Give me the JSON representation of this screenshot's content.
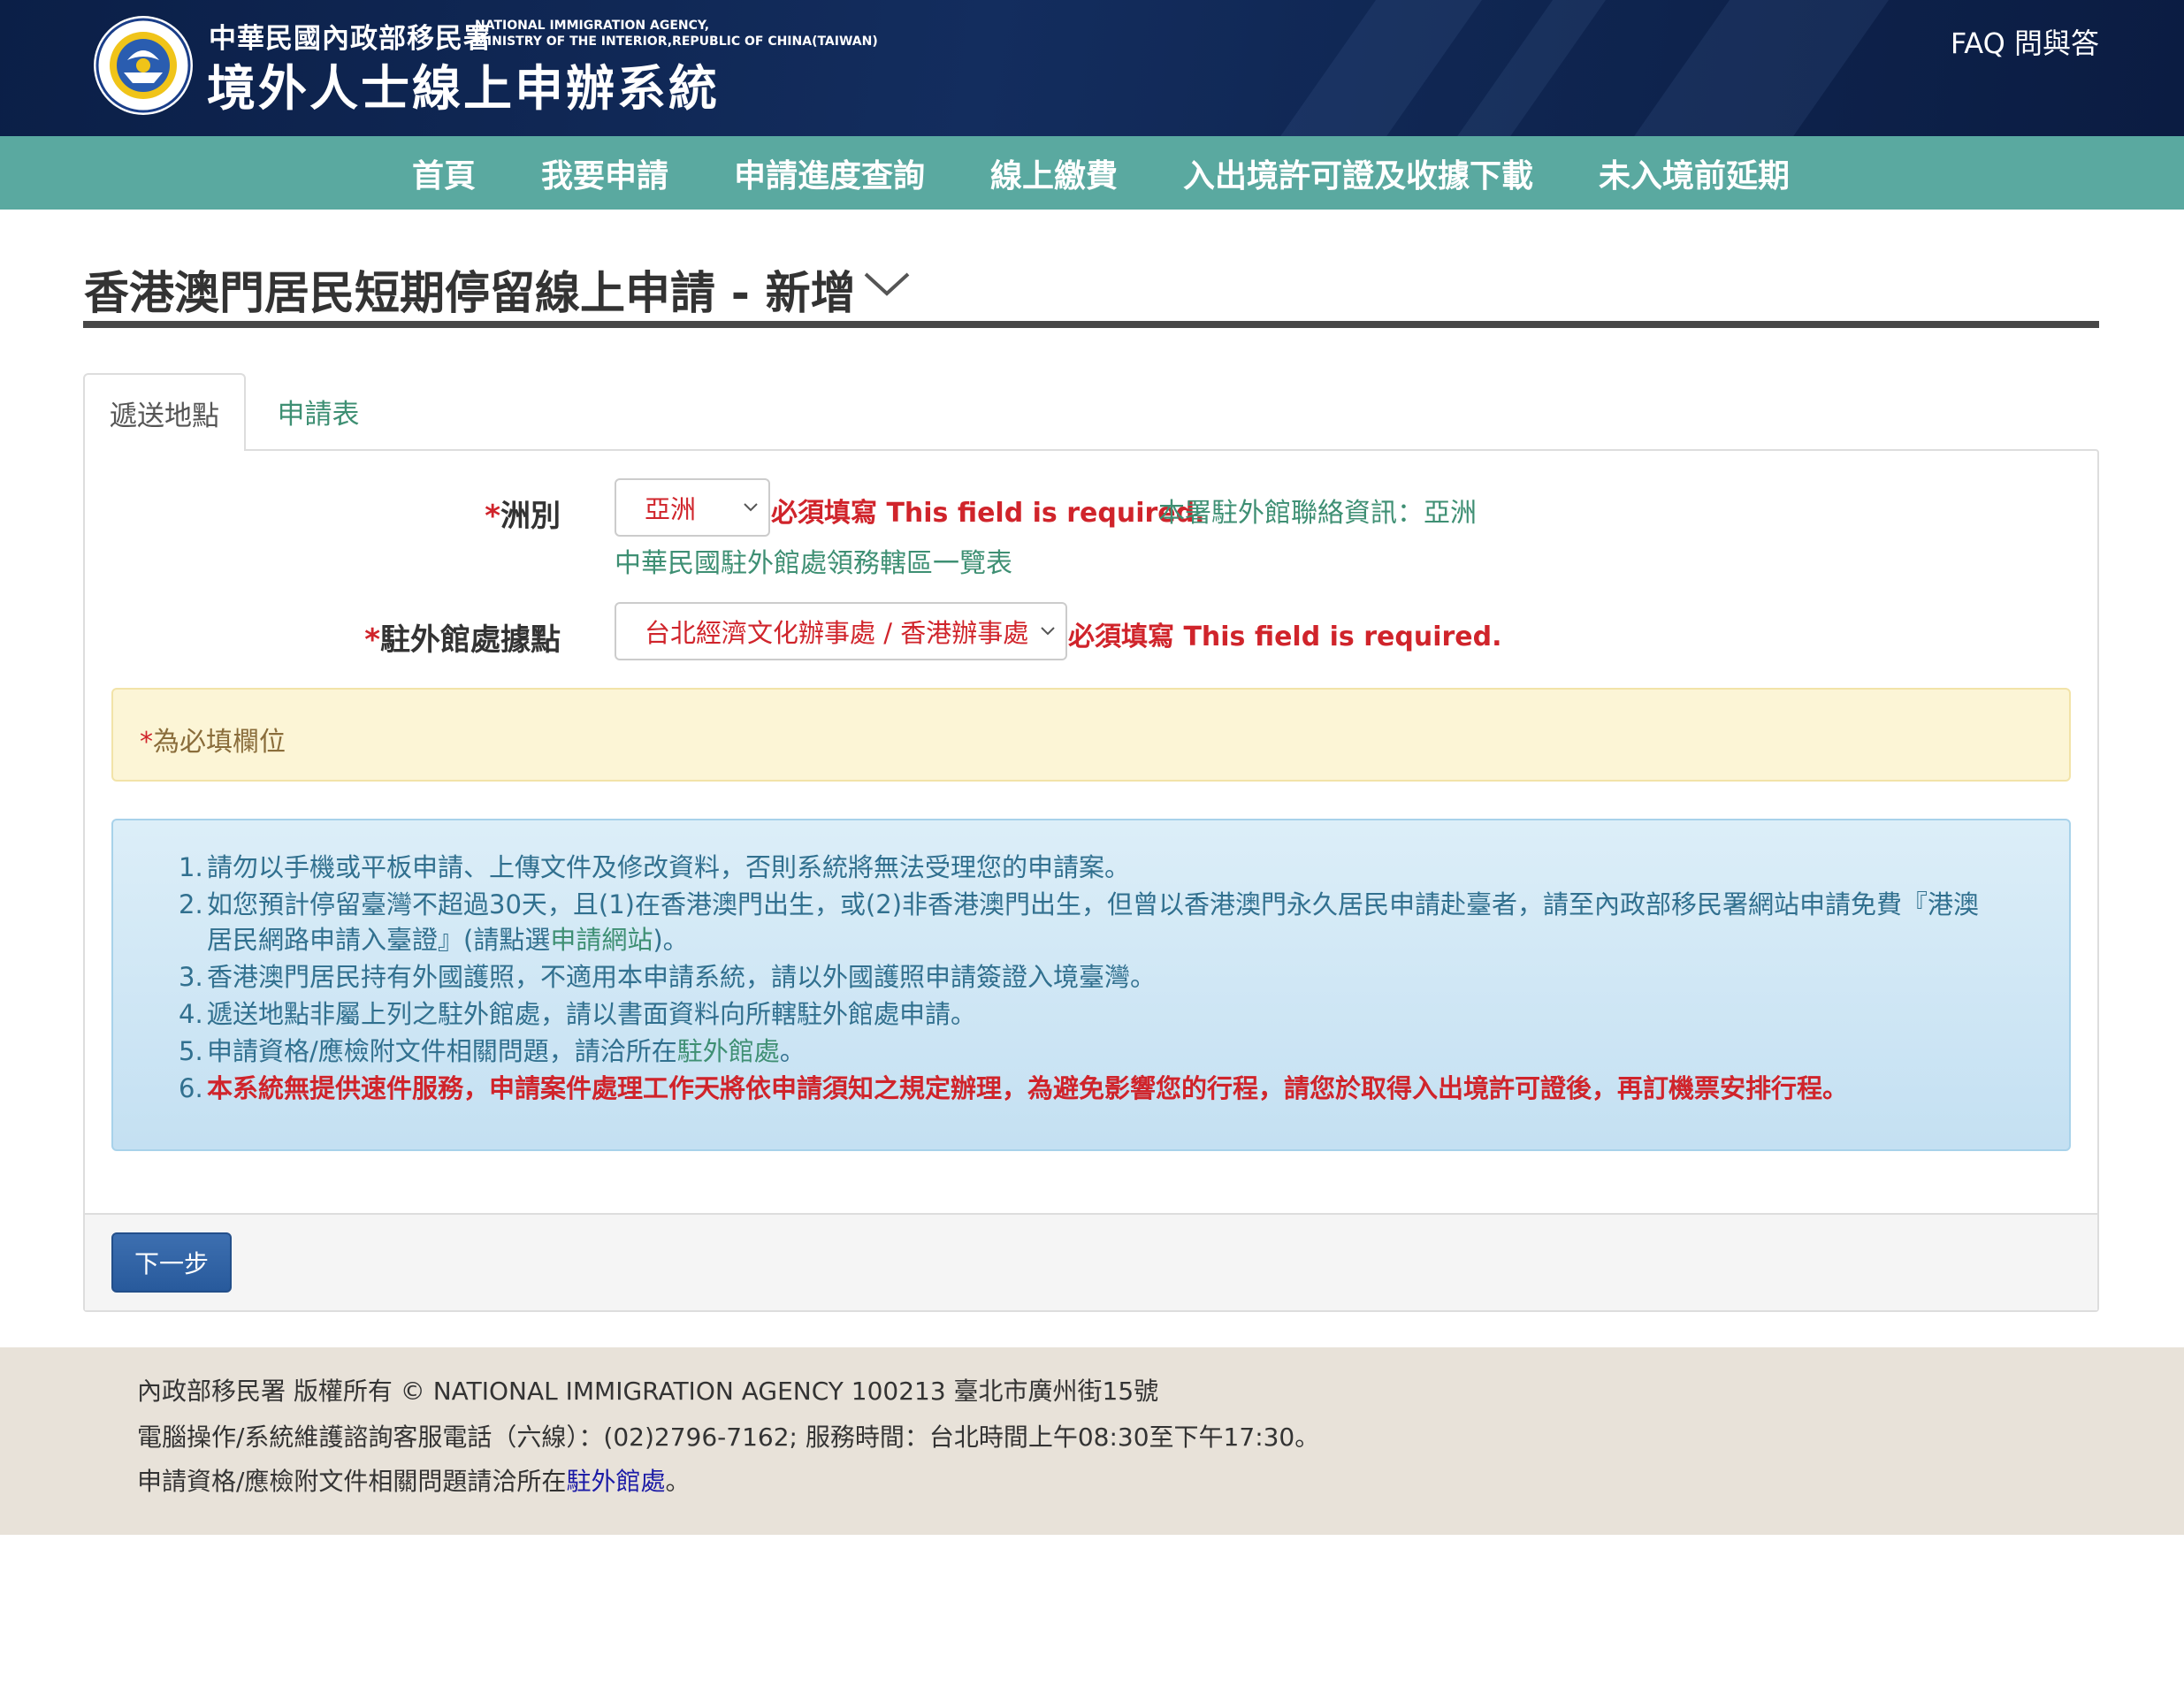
{
  "header": {
    "agency_cn": "中華民國內政部移民署",
    "agency_en_line1": "NATIONAL IMMIGRATION AGENCY,",
    "agency_en_line2": "MINISTRY OF THE INTERIOR,REPUBLIC OF CHINA(TAIWAN)",
    "system_title": "境外人士線上申辦系統",
    "faq_label": "FAQ 問與答",
    "logo_icon": "agency-emblem-icon"
  },
  "nav": {
    "items": [
      {
        "label": "首頁"
      },
      {
        "label": "我要申請"
      },
      {
        "label": "申請進度查詢"
      },
      {
        "label": "線上繳費"
      },
      {
        "label": "入出境許可證及收據下載"
      },
      {
        "label": "未入境前延期"
      }
    ]
  },
  "page": {
    "title": "香港澳門居民短期停留線上申請 - 新增",
    "title_icon": "chevron-down-icon"
  },
  "tabs": [
    {
      "label": "遞送地點",
      "active": true
    },
    {
      "label": "申請表",
      "active": false
    }
  ],
  "form": {
    "continent": {
      "required_mark": "*",
      "label": "洲別",
      "value": "亞洲",
      "error": "必須填寫 This field is required.",
      "contact_info": "本署駐外館聯絡資訊：亞洲",
      "jurisdiction_link": "中華民國駐外館處領務轄區一覽表"
    },
    "mission": {
      "required_mark": "*",
      "label": "駐外館處據點",
      "value": "台北經濟文化辦事處 / 香港辦事處",
      "error": "必須填寫 This field is required."
    }
  },
  "required_note": {
    "mark": "*",
    "text": "為必填欄位"
  },
  "notices": {
    "n1": {
      "num": "1.",
      "text": "請勿以手機或平板申請、上傳文件及修改資料，否則系統將無法受理您的申請案。"
    },
    "n2": {
      "num": "2.",
      "text": "如您預計停留臺灣不超過30天，且(1)在香港澳門出生，或(2)非香港澳門出生，但曾以香港澳門永久居民申請赴臺者，請至內政部移民署網站申請免費『港澳",
      "cont_a": "居民網路申請入臺證』(請點選",
      "cont_link": "申請網站",
      "cont_b": ")。"
    },
    "n3": {
      "num": "3.",
      "text": "香港澳門居民持有外國護照，不適用本申請系統，請以外國護照申請簽證入境臺灣。"
    },
    "n4": {
      "num": "4.",
      "text": "遞送地點非屬上列之駐外館處，請以書面資料向所轄駐外館處申請。"
    },
    "n5": {
      "num": "5.",
      "text": "申請資格/應檢附文件相關問題，請洽所在",
      "link": "駐外館處",
      "end": "。"
    },
    "n6": {
      "num": "6.",
      "text": "本系統無提供速件服務，申請案件處理工作天將依申請須知之規定辦理，為避免影響您的行程，請您於取得入出境許可證後，再訂機票安排行程。"
    }
  },
  "actions": {
    "next_label": "下一步"
  },
  "footer": {
    "line1": "內政部移民署 版權所有 © NATIONAL IMMIGRATION AGENCY 100213 臺北市廣州街15號",
    "line2": "電腦操作/系統維護諮詢客服電話（六線）：(02)2796-7162; 服務時間：台北時間上午08:30至下午17:30。",
    "line3_text": "申請資格/應檢附文件相關問題請洽所在",
    "line3_link": "駐外館處",
    "line3_end": "。"
  },
  "colors": {
    "header_bg": "#132d5e",
    "nav_bg": "#5aa9a0",
    "error_red": "#d0242b",
    "link_green": "#3e8f73",
    "info_text": "#31708f",
    "primary_button": "#285a9c",
    "footer_bg": "#e8e2d9"
  }
}
